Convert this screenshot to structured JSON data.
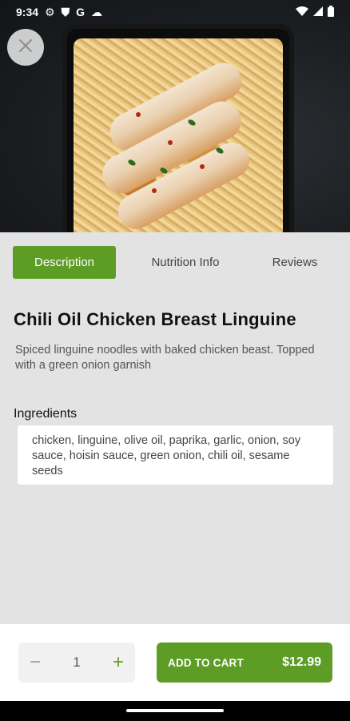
{
  "status": {
    "time": "9:34",
    "icons": [
      "settings-icon",
      "shield-icon",
      "g-icon",
      "cloud-icon"
    ],
    "system": [
      "wifi-icon",
      "signal-icon",
      "battery-icon"
    ]
  },
  "hero": {
    "close_label": "×"
  },
  "tabs": {
    "items": [
      {
        "label": "Description"
      },
      {
        "label": "Nutrition Info"
      },
      {
        "label": "Reviews"
      }
    ],
    "active_color": "#5d9c25"
  },
  "meal": {
    "title": "Chili Oil Chicken Breast Linguine",
    "description": "Spiced linguine noodles with baked chicken beast. Topped with a green onion garnish",
    "ingredients_label": "Ingredients",
    "ingredients_text": "chicken, linguine, olive oil, paprika, garlic, onion, soy sauce, hoisin sauce, green onion, chili oil, sesame seeds"
  },
  "cart": {
    "minus_label": "−",
    "quantity": "1",
    "plus_label": "+",
    "add_label": "ADD TO CART",
    "price": "$12.99",
    "brand_color": "#5d9c25"
  }
}
